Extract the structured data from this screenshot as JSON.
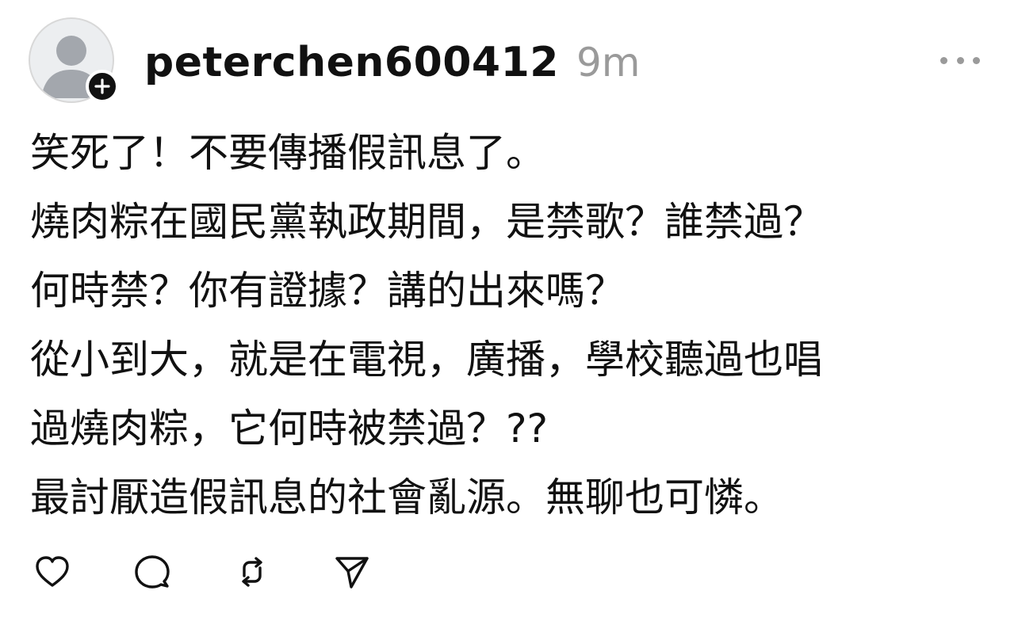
{
  "header": {
    "username": "peterchen600412",
    "timestamp": "9m",
    "avatar_icon": "default-user-avatar",
    "follow_icon": "plus-icon",
    "more_icon": "more-horizontal-icon"
  },
  "post": {
    "lines": [
      "笑死了！不要傳播假訊息了。",
      "燒肉粽在國民黨執政期間，是禁歌？誰禁過？",
      "何時禁？你有證據？講的出來嗎？",
      "從小到大，就是在電視，廣播，學校聽過也唱",
      "過燒肉粽，它何時被禁過？??",
      "最討厭造假訊息的社會亂源。無聊也可憐。"
    ]
  },
  "actions": {
    "like_icon": "heart-icon",
    "comment_icon": "comment-icon",
    "repost_icon": "repost-icon",
    "share_icon": "send-icon"
  },
  "colors": {
    "text": "#111111",
    "muted": "#9a9a9a",
    "avatar_bg": "#eceef0",
    "avatar_fg": "#a3a7ad"
  }
}
